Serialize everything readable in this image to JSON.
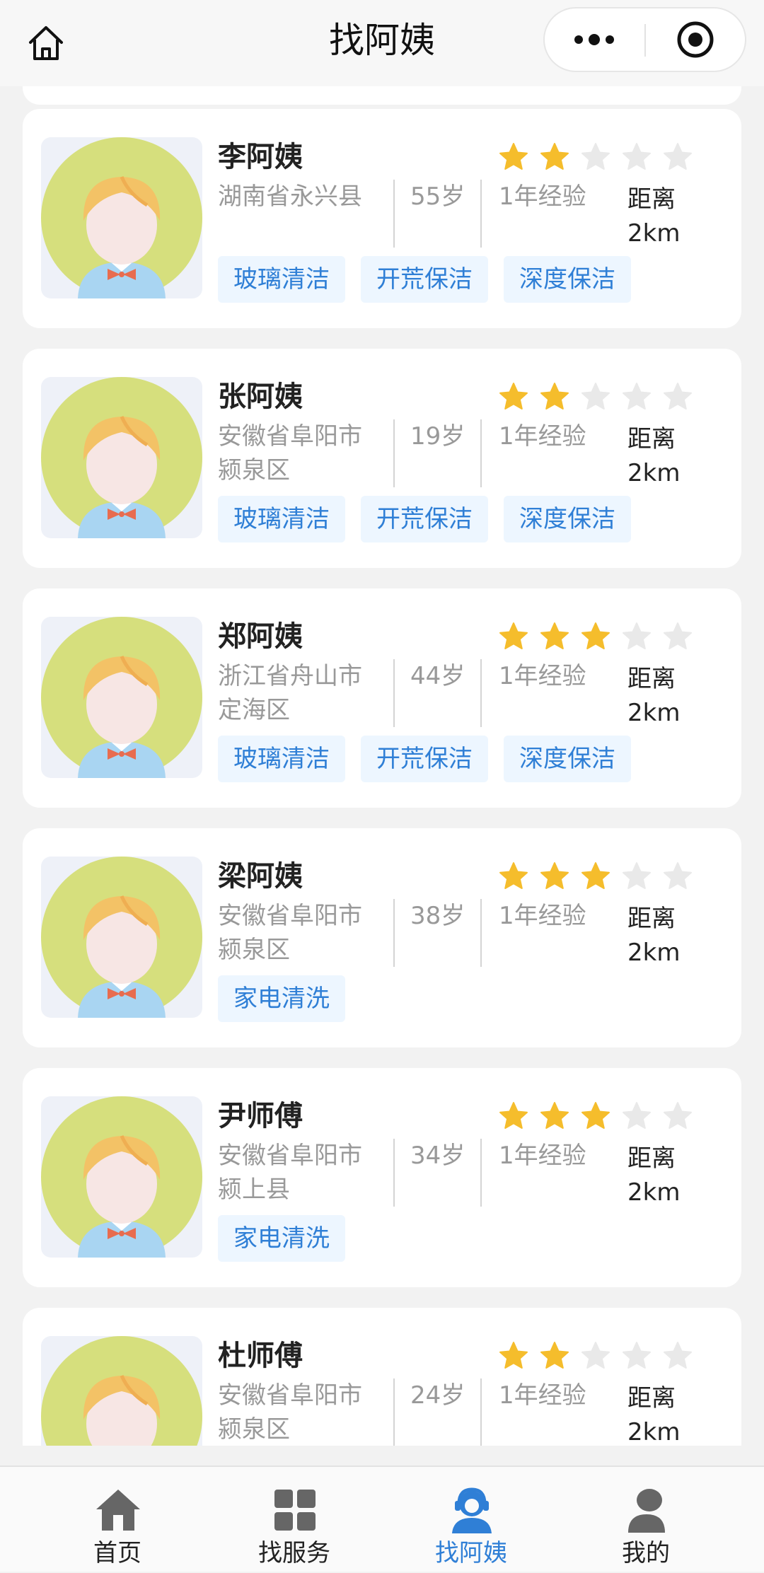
{
  "header": {
    "title": "找阿姨"
  },
  "colors": {
    "accent": "#2f7fd6",
    "star_on": "#f5bd2c",
    "star_off": "#e9e9e9",
    "tag_bg": "#edf6ff"
  },
  "workers": [
    {
      "name": "李阿姨",
      "address": "湖南省永兴县",
      "age": "55岁",
      "experience": "1年经验",
      "distance_label": "距离",
      "distance": "2km",
      "rating": 2,
      "tags": [
        "玻璃清洁",
        "开荒保洁",
        "深度保洁"
      ]
    },
    {
      "name": "张阿姨",
      "address": "安徽省阜阳市颍泉区",
      "age": "19岁",
      "experience": "1年经验",
      "distance_label": "距离",
      "distance": "2km",
      "rating": 2,
      "tags": [
        "玻璃清洁",
        "开荒保洁",
        "深度保洁"
      ]
    },
    {
      "name": "郑阿姨",
      "address": "浙江省舟山市定海区",
      "age": "44岁",
      "experience": "1年经验",
      "distance_label": "距离",
      "distance": "2km",
      "rating": 3,
      "tags": [
        "玻璃清洁",
        "开荒保洁",
        "深度保洁"
      ]
    },
    {
      "name": "梁阿姨",
      "address": "安徽省阜阳市颍泉区",
      "age": "38岁",
      "experience": "1年经验",
      "distance_label": "距离",
      "distance": "2km",
      "rating": 3,
      "tags": [
        "家电清洗"
      ]
    },
    {
      "name": "尹师傅",
      "address": "安徽省阜阳市颍上县",
      "age": "34岁",
      "experience": "1年经验",
      "distance_label": "距离",
      "distance": "2km",
      "rating": 3,
      "tags": [
        "家电清洗"
      ]
    },
    {
      "name": "杜师傅",
      "address": "安徽省阜阳市颍泉区",
      "age": "24岁",
      "experience": "1年经验",
      "distance_label": "距离",
      "distance": "2km",
      "rating": 2,
      "tags": []
    }
  ],
  "tabbar": [
    {
      "label": "首页",
      "icon": "home-icon",
      "active": false
    },
    {
      "label": "找服务",
      "icon": "grid-icon",
      "active": false
    },
    {
      "label": "找阿姨",
      "icon": "person-headset-icon",
      "active": true
    },
    {
      "label": "我的",
      "icon": "user-icon",
      "active": false
    }
  ]
}
